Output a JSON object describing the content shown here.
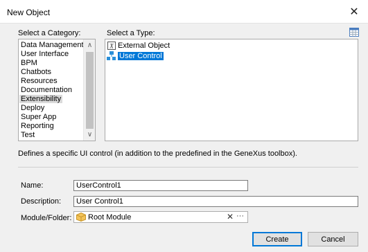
{
  "window": {
    "title": "New Object",
    "close_glyph": "✕"
  },
  "category": {
    "label": "Select a Category:",
    "items": [
      "Data Management",
      "User Interface",
      "BPM",
      "Chatbots",
      "Resources",
      "Documentation",
      "Extensibility",
      "Deploy",
      "Super App",
      "Reporting",
      "Test"
    ],
    "selected": "Extensibility",
    "scroll_up": "∧",
    "scroll_down": "∨"
  },
  "type": {
    "label": "Select a Type:",
    "items": [
      {
        "label": "External Object",
        "icon": "external-object-icon"
      },
      {
        "label": "User Control",
        "icon": "user-control-icon"
      }
    ],
    "selected": "User Control",
    "view_icon": "grid-view-icon"
  },
  "description_text": "Defines a specific UI control (in addition to the predefined in the GeneXus toolbox).",
  "form": {
    "name_label": "Name:",
    "name_value": "UserControl1",
    "description_label": "Description:",
    "description_value": "User Control1",
    "module_label": "Module/Folder:",
    "module_value": "Root Module",
    "module_clear": "✕",
    "module_browse": "···"
  },
  "buttons": {
    "create": "Create",
    "cancel": "Cancel"
  },
  "colors": {
    "selection": "#0078d7",
    "inactive_selection": "#dadada",
    "window_bg": "#f0f0f0"
  }
}
